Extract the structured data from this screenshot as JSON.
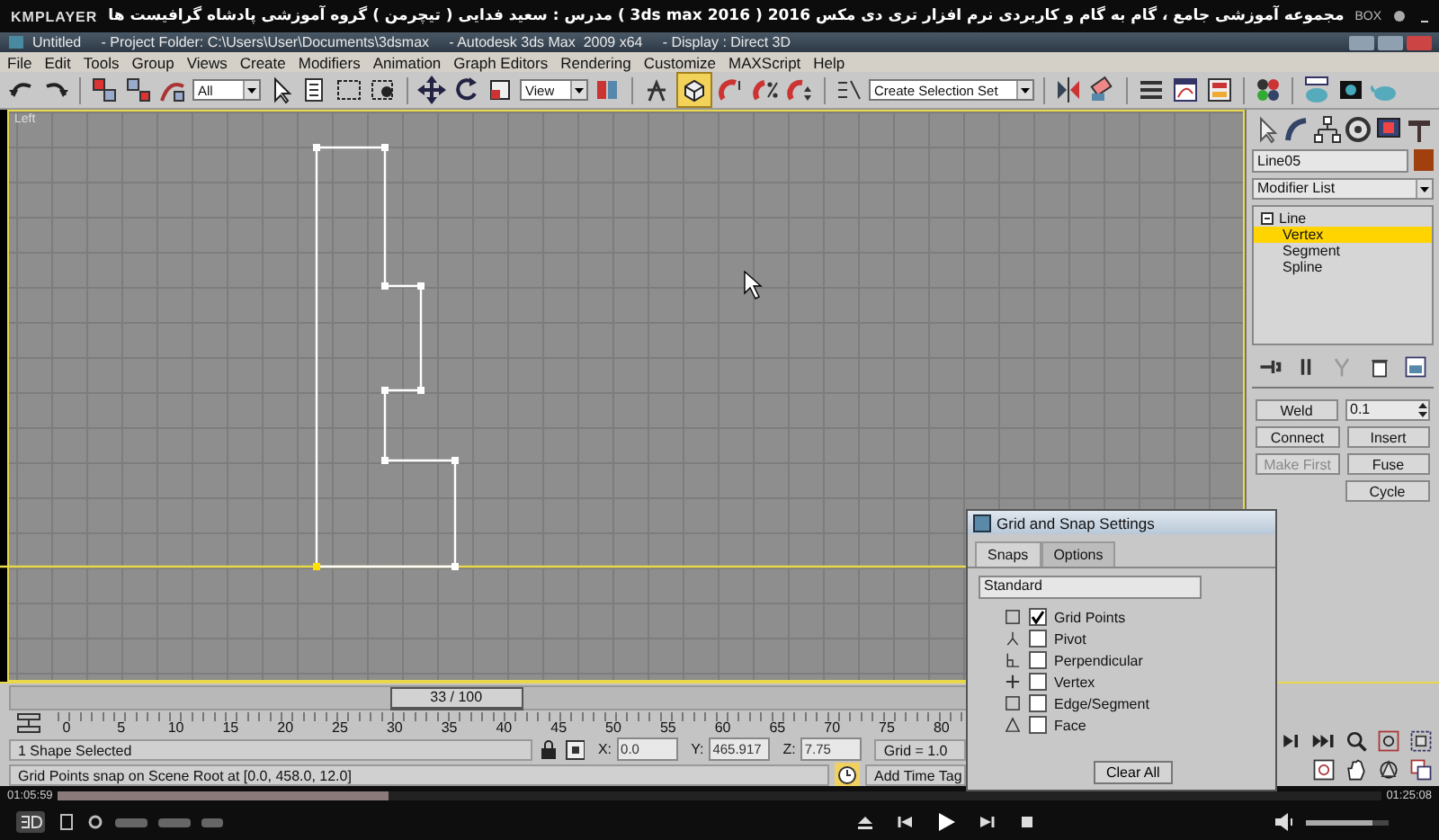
{
  "player": {
    "logo": "KMPLAYER",
    "title": "مجموعه آموزشی جامع ، گام به گام و کاربردی نرم افزار تری دی مکس 2016  ( 3ds max 2016 )  مدرس : سعید فدایی ( تیچرمن ) گروه آموزشی پادشاه گرافیست ها",
    "box_label": "BOX",
    "elapsed": "01:05:59",
    "total": "01:25:08",
    "progress": {
      "level": 0.25
    },
    "volume": {
      "level": 0.8
    }
  },
  "app": {
    "title": "Untitled     - Project Folder: C:\\Users\\User\\Documents\\3dsmax     - Autodesk 3ds Max  2009 x64     - Display : Direct 3D",
    "menu": [
      "File",
      "Edit",
      "Tools",
      "Group",
      "Views",
      "Create",
      "Modifiers",
      "Animation",
      "Graph Editors",
      "Rendering",
      "Customize",
      "MAXScript",
      "Help"
    ],
    "toolbar": {
      "selection_filter": "All",
      "reference_coord": "View",
      "named_selection": "Create Selection Set",
      "snap_on": true
    }
  },
  "viewport": {
    "label": "Left"
  },
  "command_panel": {
    "object": {
      "name": "Line05",
      "color": "#a0400f"
    },
    "modifier_list": "Modifier List",
    "stack": [
      {
        "label": "Line",
        "expanded": true,
        "selected": false,
        "children": [
          {
            "label": "Vertex",
            "selected": true
          },
          {
            "label": "Segment",
            "selected": false
          },
          {
            "label": "Spline",
            "selected": false
          }
        ]
      }
    ],
    "rollout": [
      [
        {
          "kind": "button",
          "label": "Weld",
          "disabled": false
        },
        {
          "kind": "spinner",
          "value": "0.1"
        }
      ],
      [
        {
          "kind": "button",
          "label": "Connect",
          "disabled": false
        },
        {
          "kind": "button",
          "label": "Insert",
          "disabled": false
        }
      ],
      [
        {
          "kind": "button",
          "label": "Make First",
          "disabled": true
        },
        {
          "kind": "button",
          "label": "Fuse",
          "disabled": false
        }
      ],
      [
        {
          "kind": "spacer"
        },
        {
          "kind": "button",
          "label": "Cycle",
          "disabled": false
        }
      ]
    ]
  },
  "timeline": {
    "slider": {
      "label": "33 / 100",
      "level": 0.33
    },
    "ruler_labels": [
      "0",
      "5",
      "10",
      "15",
      "20",
      "25",
      "30",
      "35",
      "40",
      "45",
      "50",
      "55",
      "60",
      "65",
      "70",
      "75",
      "80"
    ]
  },
  "status": {
    "selection": "1 Shape Selected",
    "coords": [
      {
        "label": "X:",
        "value": "0.0"
      },
      {
        "label": "Y:",
        "value": "465.917"
      },
      {
        "label": "Z:",
        "value": "7.75"
      }
    ],
    "grid": "Grid = 1.0",
    "prompt": "Grid Points snap on Scene Root at [0.0, 458.0, 12.0]",
    "time_tag": "Add Time Tag"
  },
  "dialog": {
    "title": "Grid and Snap Settings",
    "tabs": [
      {
        "label": "Snaps",
        "selected": true
      },
      {
        "label": "Options",
        "selected": false
      }
    ],
    "preset": "Standard",
    "snaps": [
      {
        "kind": "grid",
        "label": "Grid Points",
        "checked": true
      },
      {
        "kind": "pivot",
        "label": "Pivot",
        "checked": false
      },
      {
        "kind": "perpendicular",
        "label": "Perpendicular",
        "checked": false
      },
      {
        "kind": "vertex",
        "label": "Vertex",
        "checked": false
      },
      {
        "kind": "edge",
        "label": "Edge/Segment",
        "checked": false
      },
      {
        "kind": "face",
        "label": "Face",
        "checked": false
      }
    ],
    "clear_button": "Clear All"
  }
}
